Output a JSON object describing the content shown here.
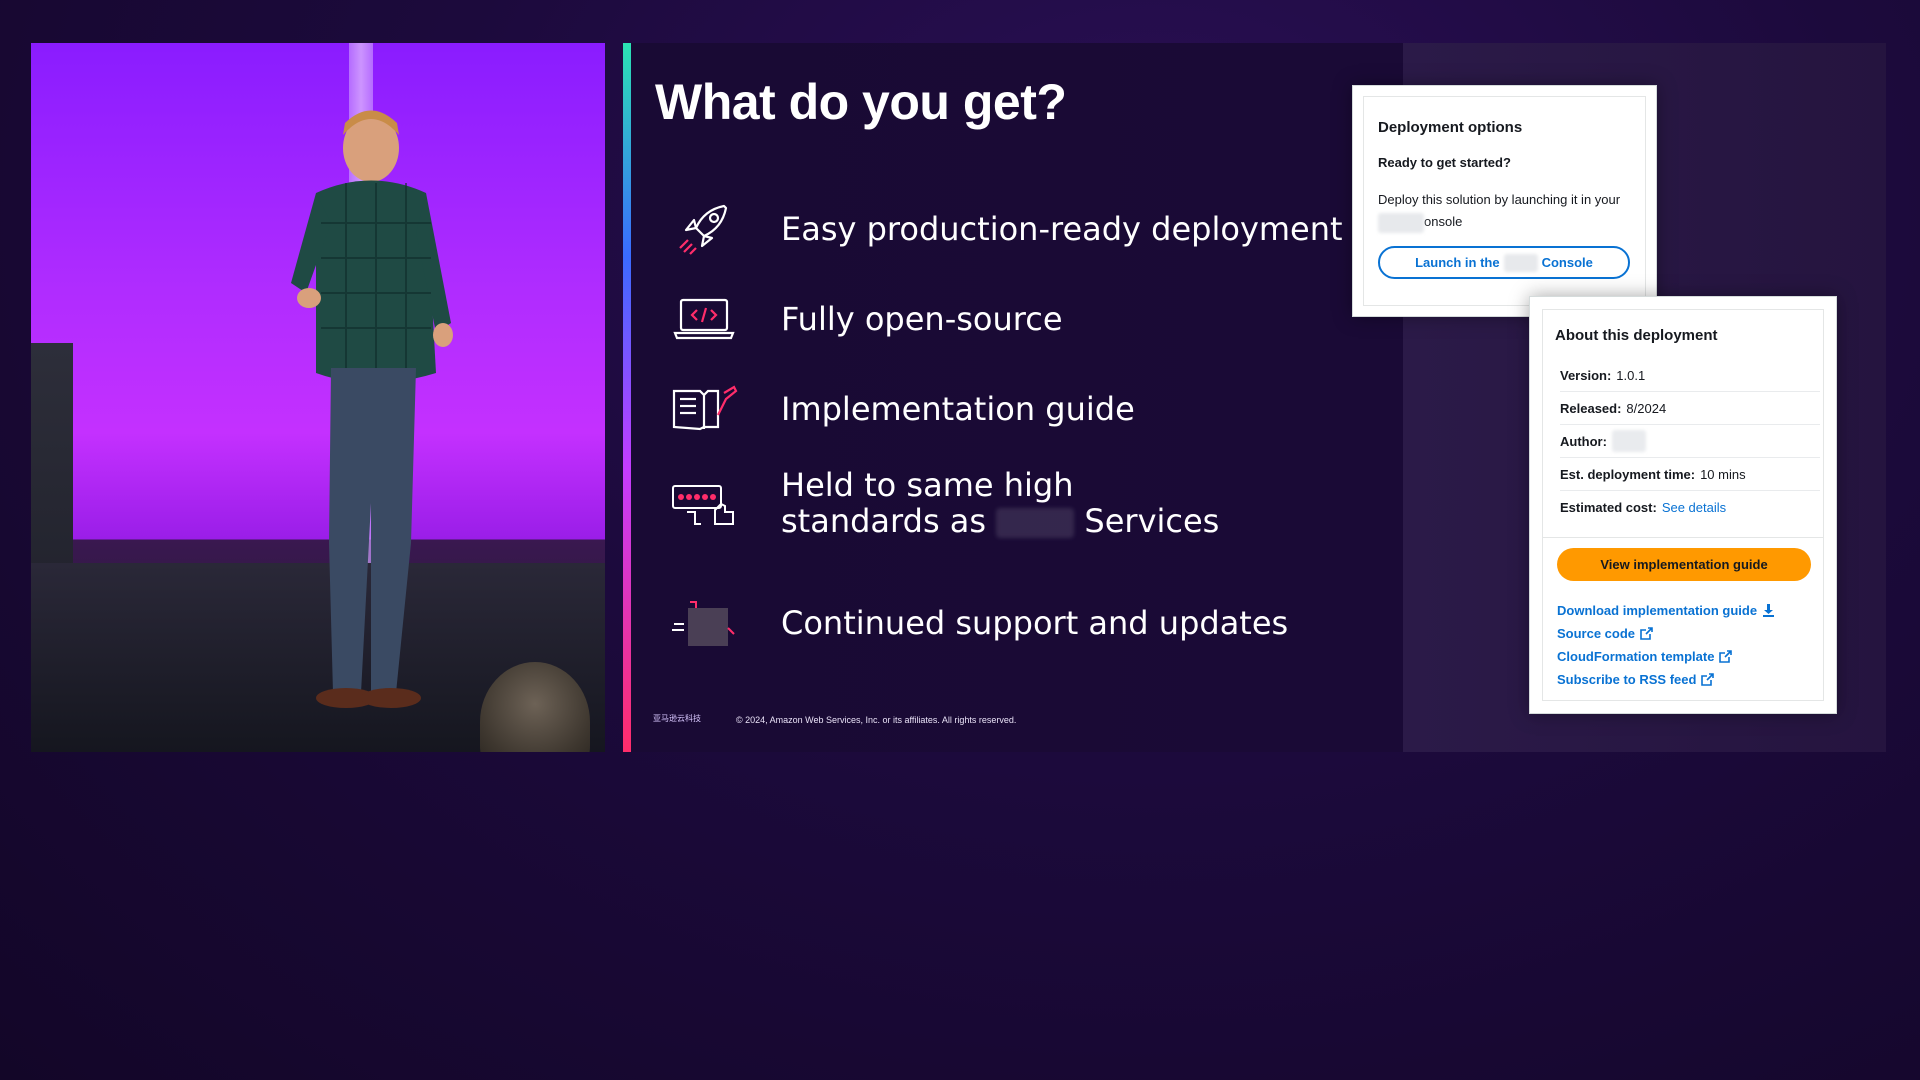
{
  "slide": {
    "title": "What do you get?",
    "features": [
      {
        "icon": "rocket-icon",
        "label": "Easy production-ready deployment"
      },
      {
        "icon": "laptop-code-icon",
        "label": "Fully open-source"
      },
      {
        "icon": "book-pencil-icon",
        "label": "Implementation guide"
      },
      {
        "icon": "rating-thumbs-up-icon",
        "label_line1": "Held to same high",
        "label_line2_prefix": "standards as",
        "label_line2_suffix": "Services"
      },
      {
        "icon": "support-tools-icon",
        "label": "Continued support and updates"
      }
    ],
    "footer_logo": "亚马逊云科技",
    "copyright": "© 2024, Amazon Web Services, Inc. or its affiliates. All rights reserved."
  },
  "deployment_options": {
    "title": "Deployment options",
    "subtitle": "Ready to get started?",
    "desc_prefix": "Deploy this solution by launching it in your",
    "desc_suffix": "onsole",
    "launch_prefix": "Launch in the",
    "launch_suffix": "Console"
  },
  "about": {
    "title": "About this deployment",
    "version_label": "Version:",
    "version_value": "1.0.1",
    "released_label": "Released:",
    "released_value": "8/2024",
    "author_label": "Author:",
    "time_label": "Est. deployment time:",
    "time_value": "10 mins",
    "cost_label": "Estimated cost:",
    "cost_link": "See details",
    "view_guide_button": "View implementation guide",
    "links": [
      {
        "label": "Download implementation guide",
        "icon": "download-icon"
      },
      {
        "label": "Source code",
        "icon": "external-link-icon"
      },
      {
        "label": "CloudFormation template",
        "icon": "external-link-icon"
      },
      {
        "label": "Subscribe to RSS feed",
        "icon": "external-link-icon"
      }
    ]
  },
  "colors": {
    "link": "#0972d3",
    "primary_button": "#ff9900",
    "slide_bg": "#190a34",
    "accent_pink": "#ff2d6a"
  }
}
